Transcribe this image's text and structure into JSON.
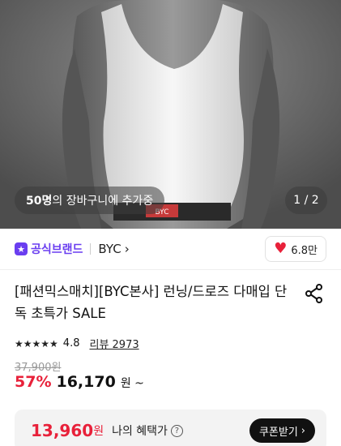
{
  "hero": {
    "cart_count": "50명",
    "cart_text": "의 장바구니에 추가중",
    "page_indicator": "1 / 2",
    "waistband_text": "BYC"
  },
  "brand": {
    "official_label": "공식브랜드",
    "name": "BYC",
    "likes": "6.8만"
  },
  "product": {
    "title": "[패션믹스매치][BYC본사] 런닝/드로즈 다매입 단독 초특가 SALE",
    "rating": "4.8",
    "review_label": "리뷰 2973",
    "original_price": "37,900원",
    "discount": "57%",
    "sale_price": "16,170",
    "sale_unit": "원 ~"
  },
  "benefit": {
    "price": "13,960",
    "unit": "원",
    "label": "나의 혜택가",
    "coupon_label": "쿠폰받기"
  },
  "colors": {
    "accent_red": "#e8213a",
    "brand_purple": "#6a3ef0"
  }
}
